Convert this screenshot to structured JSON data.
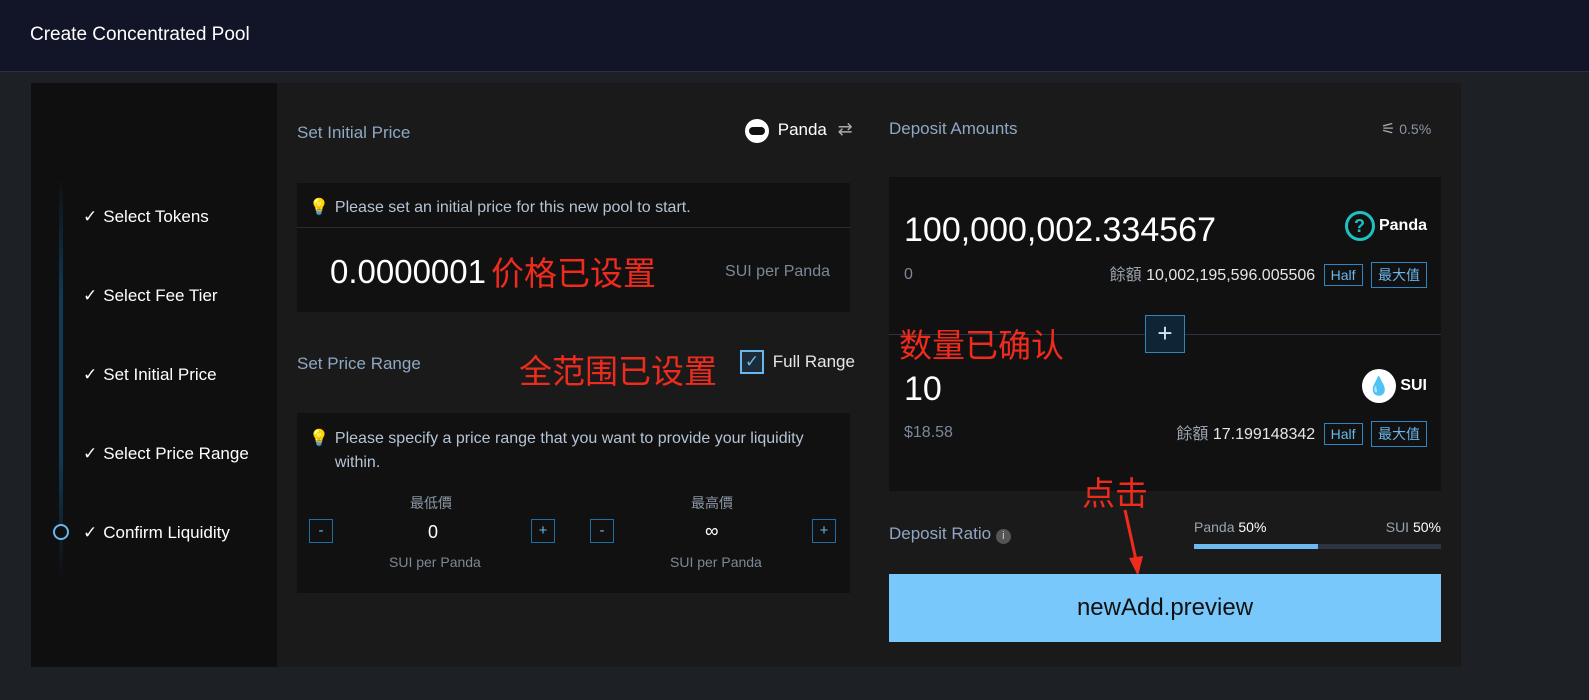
{
  "header": {
    "title": "Create Concentrated Pool"
  },
  "steps": [
    {
      "check": "✓",
      "label": "Select Tokens"
    },
    {
      "check": "✓",
      "label": "Select Fee Tier"
    },
    {
      "check": "✓",
      "label": "Set Initial Price"
    },
    {
      "check": "✓",
      "label": "Select Price Range"
    },
    {
      "check": "✓",
      "label": "Confirm Liquidity"
    }
  ],
  "initial_price": {
    "title": "Set Initial Price",
    "token": "Panda",
    "hint": "Please set an initial price for this new pool to start.",
    "value": "0.0000001",
    "unit": "SUI per Panda"
  },
  "price_range": {
    "title": "Set Price Range",
    "full_range_label": "Full Range",
    "full_range_checked": true,
    "hint": "Please specify a price range that you want to provide your liquidity within.",
    "min": {
      "label": "最低價",
      "value": "0",
      "unit": "SUI per Panda"
    },
    "max": {
      "label": "最高價",
      "value": "∞",
      "unit": "SUI per Panda"
    },
    "minus": "-",
    "plus": "+"
  },
  "deposit": {
    "title": "Deposit Amounts",
    "slippage": "0.5%",
    "token_a": {
      "amount": "100,000,002.334567",
      "usd": "0",
      "symbol": "Panda",
      "balance_label": "餘額",
      "balance": "10,002,195,596.005506"
    },
    "token_b": {
      "amount": "10",
      "usd": "$18.58",
      "symbol": "SUI",
      "balance_label": "餘額",
      "balance": "17.199148342"
    },
    "half_label": "Half",
    "max_label": "最大值",
    "add_icon": "+"
  },
  "ratio": {
    "title": "Deposit Ratio",
    "a_name": "Panda",
    "a_pct": "50%",
    "b_name": "SUI",
    "b_pct": "50%",
    "fill": 0.5
  },
  "preview_button": "newAdd.preview",
  "annotations": {
    "price_set": "价格已设置",
    "range_set": "全范围已设置",
    "qty_confirmed": "数量已确认",
    "click": "点击"
  },
  "colors": {
    "accent": "#79c8fc",
    "annotation": "#ee2b1c",
    "link": "#6bb6ea"
  }
}
